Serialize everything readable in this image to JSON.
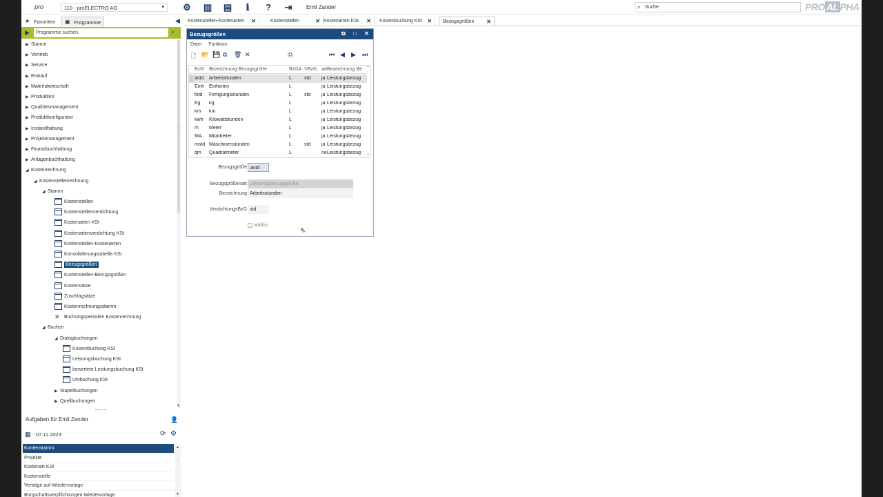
{
  "topbar": {
    "logo": "pro",
    "client": "110 - proELECTRO AG",
    "user": "Emil Zander",
    "search_value": "Suche",
    "brand_left": "PRO",
    "brand_mid": "AL",
    "brand_right": "PHA",
    "icons": [
      "gear-icon",
      "panel-icon",
      "window-icon",
      "info-icon",
      "help-icon",
      "logout-icon"
    ]
  },
  "left_tabs": {
    "favorites": "Favoriten",
    "programs": "Programme"
  },
  "program_search": {
    "placeholder": "Programme suchen"
  },
  "tree": [
    {
      "label": "Stamm",
      "level": 0,
      "type": "folder",
      "state": "collapsed"
    },
    {
      "label": "Vertrieb",
      "level": 0,
      "type": "folder",
      "state": "collapsed"
    },
    {
      "label": "Service",
      "level": 0,
      "type": "folder",
      "state": "collapsed"
    },
    {
      "label": "Einkauf",
      "level": 0,
      "type": "folder",
      "state": "collapsed"
    },
    {
      "label": "Materialwirtschaft",
      "level": 0,
      "type": "folder",
      "state": "collapsed"
    },
    {
      "label": "Produktion",
      "level": 0,
      "type": "folder",
      "state": "collapsed"
    },
    {
      "label": "Qualitätsmanagement",
      "level": 0,
      "type": "folder",
      "state": "collapsed"
    },
    {
      "label": "Produktkonfigurator",
      "level": 0,
      "type": "folder",
      "state": "collapsed"
    },
    {
      "label": "Instandhaltung",
      "level": 0,
      "type": "folder",
      "state": "collapsed"
    },
    {
      "label": "Projektmanagement",
      "level": 0,
      "type": "folder",
      "state": "collapsed"
    },
    {
      "label": "Finanzbuchhaltung",
      "level": 0,
      "type": "folder",
      "state": "collapsed"
    },
    {
      "label": "Anlagenbuchhaltung",
      "level": 0,
      "type": "folder",
      "state": "collapsed"
    },
    {
      "label": "Kostenrechnung",
      "level": 0,
      "type": "folder",
      "state": "expanded"
    },
    {
      "label": "Kostenstellenrechnung",
      "level": 1,
      "type": "folder",
      "state": "expanded"
    },
    {
      "label": "Stamm",
      "level": 2,
      "type": "folder",
      "state": "expanded"
    },
    {
      "label": "Kostenstellen",
      "level": 3,
      "type": "page"
    },
    {
      "label": "Kostenstellenverdichtung",
      "level": 3,
      "type": "page"
    },
    {
      "label": "Kostenarten KSt",
      "level": 3,
      "type": "page"
    },
    {
      "label": "Kostenartenverdichtung KSt",
      "level": 3,
      "type": "page"
    },
    {
      "label": "Kostenstellen-Kostenarten",
      "level": 3,
      "type": "page"
    },
    {
      "label": "Konsolidierungstabelle KSt",
      "level": 3,
      "type": "page"
    },
    {
      "label": "Bezugsgrößen",
      "level": 3,
      "type": "page",
      "selected": true
    },
    {
      "label": "Kostenstellen-Bezugsgrößen",
      "level": 3,
      "type": "page"
    },
    {
      "label": "Kostensätze",
      "level": 3,
      "type": "page"
    },
    {
      "label": "Zuschlagsätze",
      "level": 3,
      "type": "page"
    },
    {
      "label": "Kostenrechnungsstamm",
      "level": 3,
      "type": "page"
    },
    {
      "label": "Buchungsperioden Kostenrechnung",
      "level": 3,
      "type": "tools"
    },
    {
      "label": "Buchen",
      "level": 2,
      "type": "folder",
      "state": "expanded"
    },
    {
      "label": "Dialogbuchungen",
      "level": 3,
      "type": "folder",
      "state": "expanded"
    },
    {
      "label": "Kostenbuchung KSt",
      "level": 4,
      "type": "page"
    },
    {
      "label": "Leistungsbuchung KSt",
      "level": 4,
      "type": "page"
    },
    {
      "label": "bewertete Leistungsbuchung KSt",
      "level": 4,
      "type": "page"
    },
    {
      "label": "Umbuchung KSt",
      "level": 4,
      "type": "page"
    },
    {
      "label": "Stapelbuchungen",
      "level": 3,
      "type": "folder",
      "state": "collapsed"
    },
    {
      "label": "Quellbuchungen",
      "level": 3,
      "type": "folder",
      "state": "collapsed"
    }
  ],
  "tasks": {
    "title": "Aufgaben für Emil Zander",
    "date": "07.11.2023",
    "items": [
      {
        "label": "Kontenstamm",
        "selected": true
      },
      {
        "label": "Projekte"
      },
      {
        "label": "Kostenart KSt"
      },
      {
        "label": "Kostenstelle"
      },
      {
        "label": "Verträge auf Wiedervorlage"
      },
      {
        "label": "Bürgschaftsverpflichtungen Wiedervorlage"
      }
    ]
  },
  "doc_tabs": [
    {
      "label": "Kostenstellen-Kostenarten",
      "closable": true
    },
    {
      "label": "Kostenstellen",
      "closable": true
    },
    {
      "label": "Kostenarten KSt",
      "closable": true
    },
    {
      "label": "Kostenbuchung KSt",
      "closable": true
    },
    {
      "label": "Bezugsgrößen",
      "closable": true,
      "active": true
    }
  ],
  "panel": {
    "title": "Bezugsgrößen",
    "menu": [
      "Datei",
      "Funktion"
    ],
    "grid": {
      "headers": [
        "BzG",
        "Bezeichnung Bezugsgröße",
        "BzGA",
        "VBzG",
        "ad",
        "Bezeichnung Be"
      ],
      "rows": [
        [
          "astd",
          "Arbeitsstunden",
          "L",
          "std",
          "ja",
          "Leistungsbezug"
        ],
        [
          "Einh",
          "Einheiten",
          "L",
          "",
          "ja",
          "Leistungsbezug"
        ],
        [
          "fstd",
          "Fertigungsstunden",
          "L",
          "std",
          "ja",
          "Leistungsbezug"
        ],
        [
          "Kg",
          "kg",
          "L",
          "",
          "ja",
          "Leistungsbezug"
        ],
        [
          "km",
          "km",
          "L",
          "",
          "ja",
          "Leistungsbezug"
        ],
        [
          "kwh",
          "Kilowattstunden",
          "L",
          "",
          "ja",
          "Leistungsbezug"
        ],
        [
          "m",
          "Meter",
          "L",
          "",
          "ja",
          "Leistungsbezug"
        ],
        [
          "MA",
          "Mitarbeiter",
          "L",
          "",
          "ja",
          "Leistungsbezug"
        ],
        [
          "mstd",
          "Maschinenstunden",
          "L",
          "std",
          "ja",
          "Leistungsbezug"
        ],
        [
          "qm",
          "Quadratmeter",
          "L",
          "",
          "ne",
          "Leistungsbezug"
        ]
      ]
    },
    "form": {
      "code_label": "Bezugsgröße",
      "code_value": "astd",
      "type_label": "Bezugsgrößenart",
      "type_value": "Leistungsbezugsgröße",
      "desc_label": "Bezeichnung",
      "desc_value": "Arbeitsstunden",
      "vbzg_label": "VerdichtungsBzG",
      "vbzg_value": "std",
      "additive_label": "additiv"
    }
  }
}
